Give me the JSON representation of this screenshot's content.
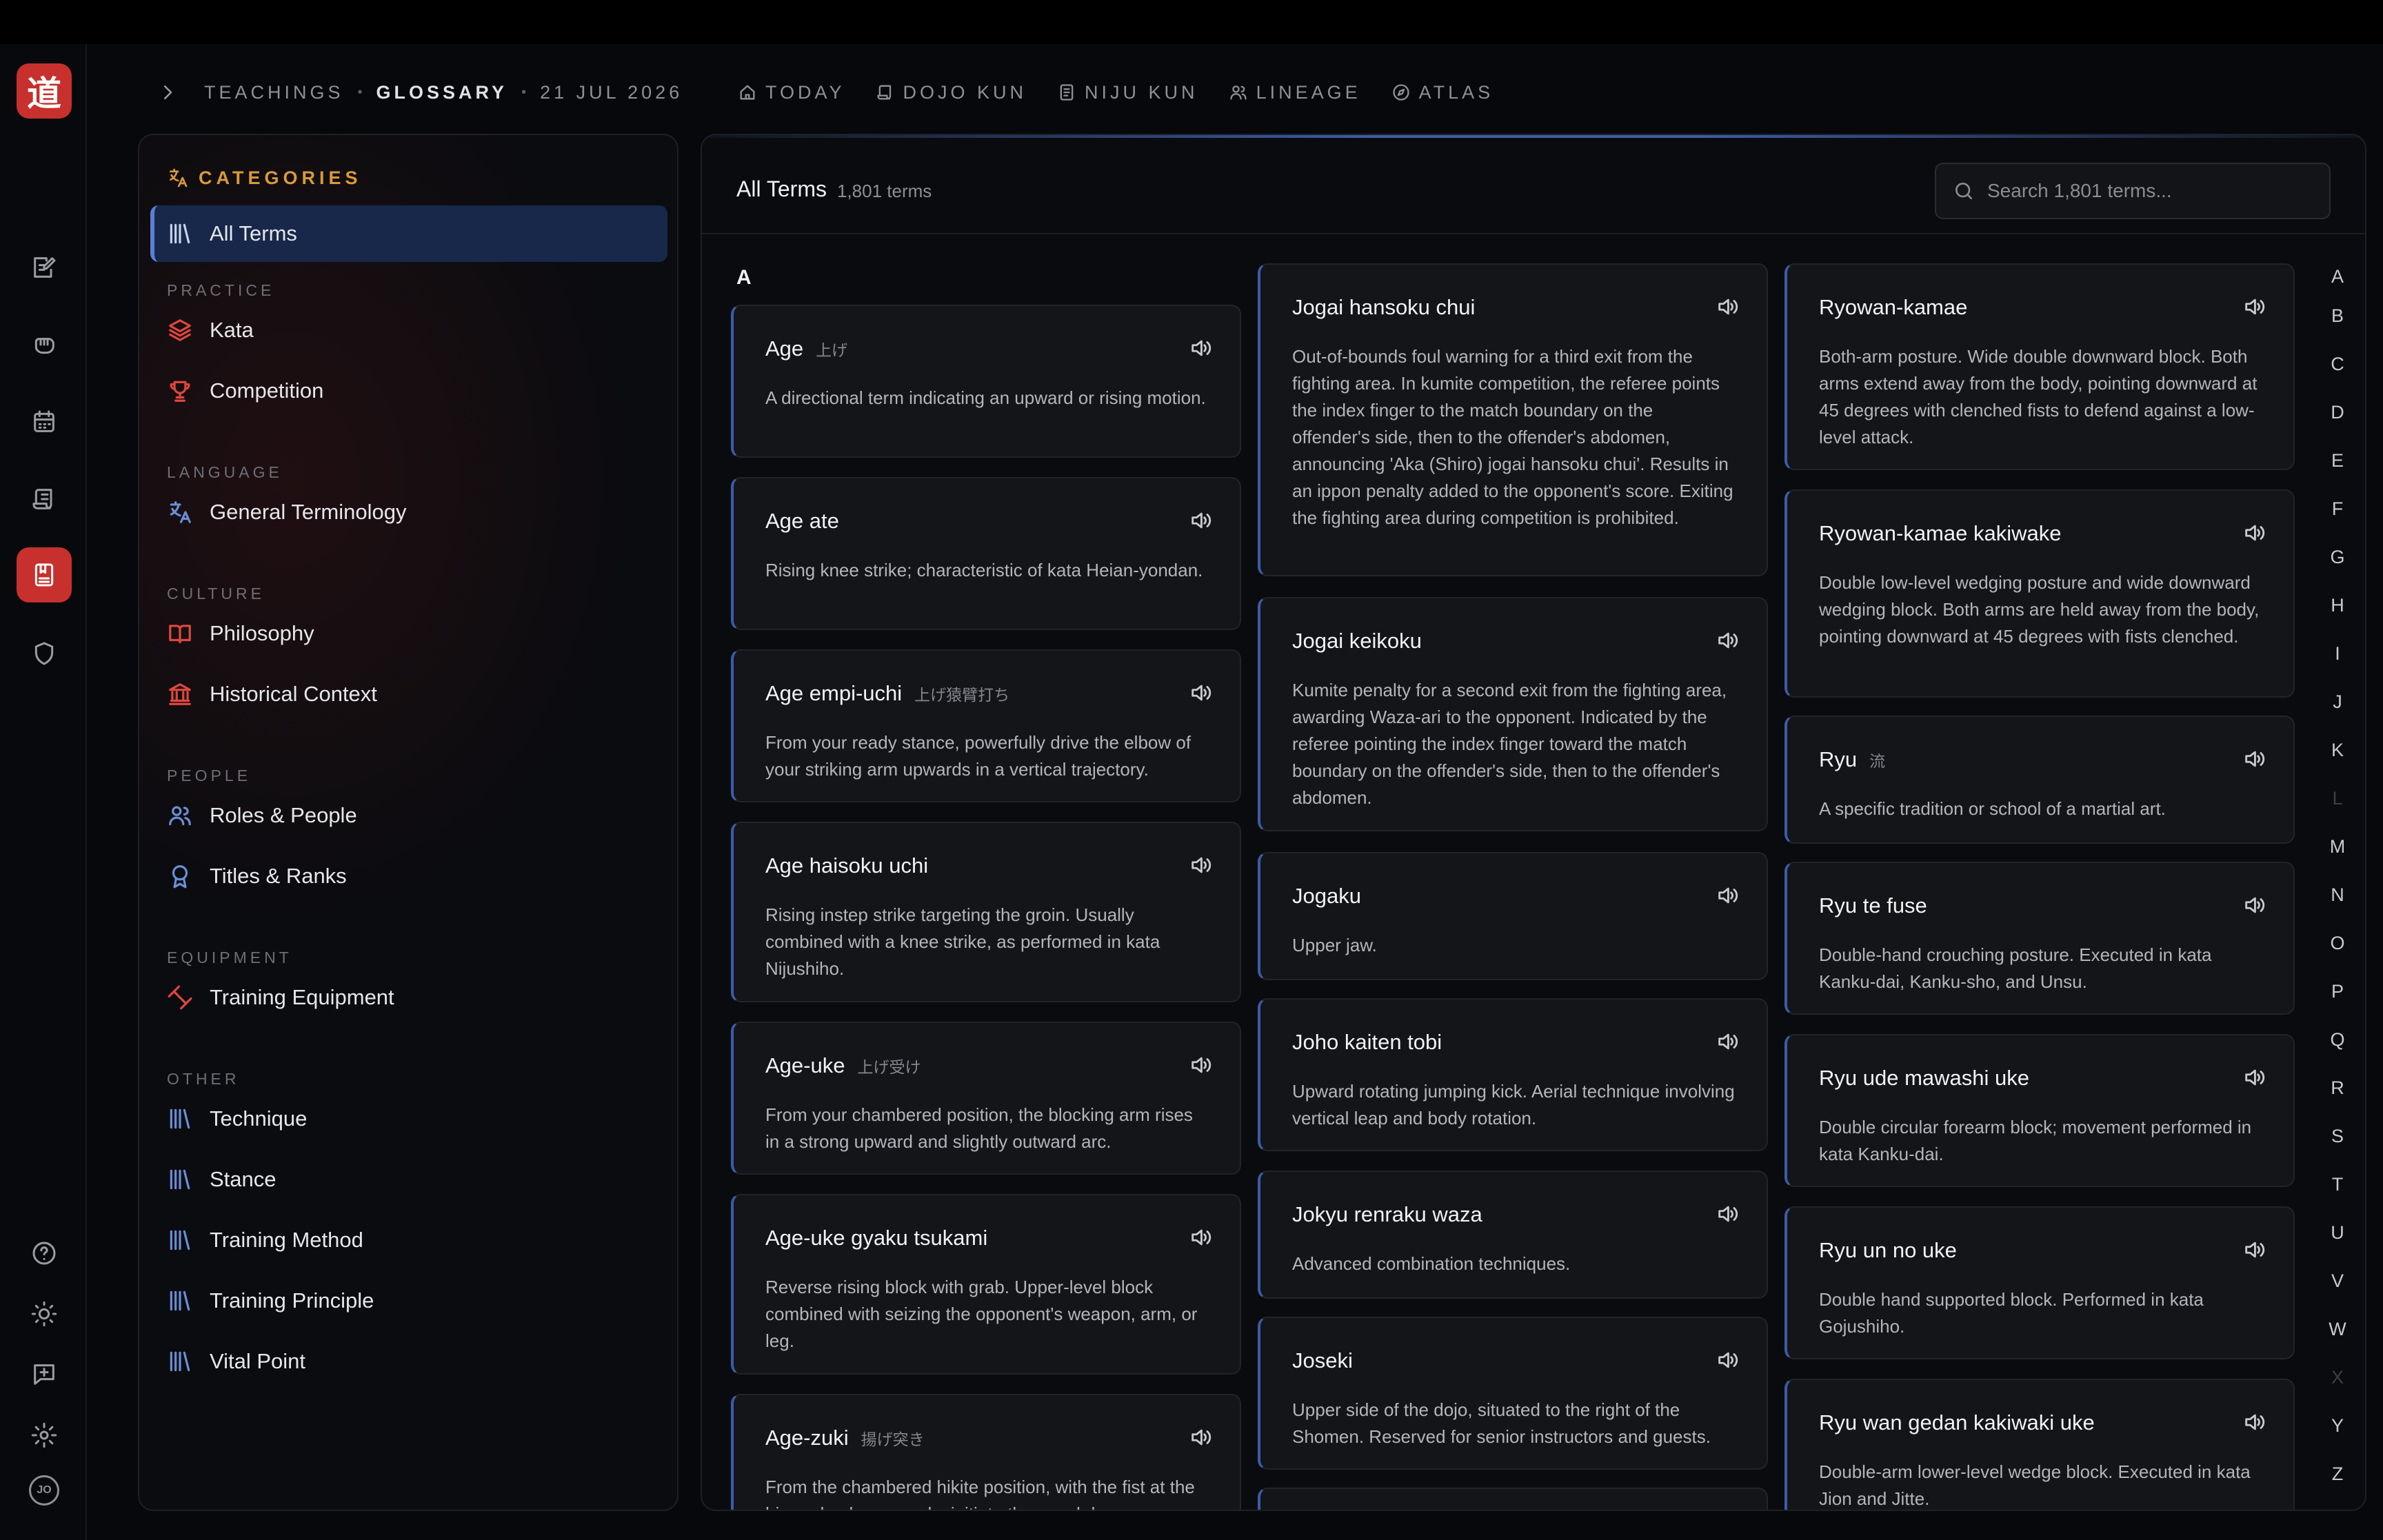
{
  "app": {
    "logo_glyph": "道",
    "brand_color": "#c7302c",
    "accent_color": "#3b5ca8",
    "category_heading_color": "#d99a3a"
  },
  "rail": {
    "items": [
      {
        "icon": "edit-note-icon"
      },
      {
        "icon": "fist-icon"
      },
      {
        "icon": "calendar-icon"
      },
      {
        "icon": "scroll-icon"
      },
      {
        "icon": "book-icon",
        "active": true
      },
      {
        "icon": "shield-icon"
      }
    ],
    "bottom_items": [
      {
        "icon": "help-icon"
      },
      {
        "icon": "sun-icon"
      },
      {
        "icon": "add-comment-icon"
      },
      {
        "icon": "settings-icon"
      }
    ],
    "avatar_initials": "JO"
  },
  "breadcrumb": {
    "section": "TEACHINGS",
    "current": "GLOSSARY",
    "date": "21 JUL 2026",
    "separator": "•"
  },
  "topnav": [
    {
      "label": "TODAY",
      "icon": "home-icon"
    },
    {
      "label": "DOJO KUN",
      "icon": "scroll-icon"
    },
    {
      "label": "NIJU KUN",
      "icon": "document-icon"
    },
    {
      "label": "LINEAGE",
      "icon": "people-icon"
    },
    {
      "label": "ATLAS",
      "icon": "compass-icon"
    }
  ],
  "categories": {
    "heading": "CATEGORIES",
    "all_terms": "All Terms",
    "groups": [
      {
        "label": "PRACTICE",
        "items": [
          {
            "label": "Kata",
            "icon": "layers-icon"
          },
          {
            "label": "Competition",
            "icon": "trophy-icon"
          }
        ]
      },
      {
        "label": "LANGUAGE",
        "items": [
          {
            "label": "General Terminology",
            "icon": "translate-icon"
          }
        ]
      },
      {
        "label": "CULTURE",
        "items": [
          {
            "label": "Philosophy",
            "icon": "open-book-icon"
          },
          {
            "label": "Historical Context",
            "icon": "temple-icon"
          }
        ]
      },
      {
        "label": "PEOPLE",
        "items": [
          {
            "label": "Roles & People",
            "icon": "people-icon"
          },
          {
            "label": "Titles & Ranks",
            "icon": "award-icon"
          }
        ]
      },
      {
        "label": "EQUIPMENT",
        "items": [
          {
            "label": "Training Equipment",
            "icon": "dumbbell-icon"
          }
        ]
      },
      {
        "label": "OTHER",
        "items": [
          {
            "label": "Technique",
            "icon": "library-icon"
          },
          {
            "label": "Stance",
            "icon": "library-icon"
          },
          {
            "label": "Training Method",
            "icon": "library-icon"
          },
          {
            "label": "Training Principle",
            "icon": "library-icon"
          },
          {
            "label": "Vital Point",
            "icon": "library-icon"
          }
        ]
      }
    ]
  },
  "terms": {
    "title": "All Terms",
    "count": "1,801 terms",
    "search_placeholder": "Search 1,801 terms...",
    "section_letter": "A",
    "columns": [
      [
        {
          "term": "Age",
          "jp": "上げ",
          "desc": "A directional term indicating an upward or rising motion."
        },
        {
          "term": "Age ate",
          "jp": "",
          "desc": "Rising knee strike; characteristic of kata Heian-yondan."
        },
        {
          "term": "Age empi-uchi",
          "jp": "上げ猿臂打ち",
          "desc": "From your ready stance, powerfully drive the elbow of your striking arm upwards in a vertical trajectory."
        },
        {
          "term": "Age haisoku uchi",
          "jp": "",
          "desc": "Rising instep strike targeting the groin. Usually combined with a knee strike, as performed in kata Nijushiho."
        },
        {
          "term": "Age-uke",
          "jp": "上げ受け",
          "desc": "From your chambered position, the blocking arm rises in a strong upward and slightly outward arc."
        },
        {
          "term": "Age-uke gyaku tsukami",
          "jp": "",
          "desc": "Reverse rising block with grab. Upper-level block combined with seizing the opponent's weapon, arm, or leg."
        },
        {
          "term": "Age-zuki",
          "jp": "揚げ突き",
          "desc": "From the chambered hikite position, with the fist at the hip and palm upwards, initiate the punch by"
        }
      ],
      [
        {
          "term": "Jogai hansoku chui",
          "jp": "",
          "desc": "Out-of-bounds foul warning for a third exit from the fighting area. In kumite competition, the referee points the index finger to the match boundary on the offender's side, then to the offender's abdomen, announcing 'Aka (Shiro) jogai hansoku chui'. Results in an ippon penalty added to the opponent's score. Exiting the fighting area during competition is prohibited."
        },
        {
          "term": "Jogai keikoku",
          "jp": "",
          "desc": "Kumite penalty for a second exit from the fighting area, awarding Waza-ari to the opponent. Indicated by the referee pointing the index finger toward the match boundary on the offender's side, then to the offender's abdomen."
        },
        {
          "term": "Jogaku",
          "jp": "",
          "desc": "Upper jaw."
        },
        {
          "term": "Joho kaiten tobi",
          "jp": "",
          "desc": "Upward rotating jumping kick. Aerial technique involving vertical leap and body rotation."
        },
        {
          "term": "Jokyu renraku waza",
          "jp": "",
          "desc": "Advanced combination techniques."
        },
        {
          "term": "Joseki",
          "jp": "",
          "desc": "Upper side of the dojo, situated to the right of the Shomen. Reserved for senior instructors and guests."
        },
        {
          "term": "",
          "jp": "",
          "desc": ""
        }
      ],
      [
        {
          "term": "Ryowan-kamae",
          "jp": "",
          "desc": "Both-arm posture. Wide double downward block. Both arms extend away from the body, pointing downward at 45 degrees with clenched fists to defend against a low-level attack."
        },
        {
          "term": "Ryowan-kamae kakiwake",
          "jp": "",
          "desc": "Double low-level wedging posture and wide downward wedging block. Both arms are held away from the body, pointing downward at 45 degrees with fists clenched."
        },
        {
          "term": "Ryu",
          "jp": "流",
          "desc": "A specific tradition or school of a martial art."
        },
        {
          "term": "Ryu te fuse",
          "jp": "",
          "desc": "Double-hand crouching posture. Executed in kata Kanku-dai, Kanku-sho, and Unsu."
        },
        {
          "term": "Ryu ude mawashi uke",
          "jp": "",
          "desc": "Double circular forearm block; movement performed in kata Kanku-dai."
        },
        {
          "term": "Ryu un no uke",
          "jp": "",
          "desc": "Double hand supported block. Performed in kata Gojushiho."
        },
        {
          "term": "Ryu wan gedan kakiwaki uke",
          "jp": "",
          "desc": "Double-arm lower-level wedge block. Executed in kata Jion and Jitte."
        }
      ]
    ]
  },
  "alphabet": [
    {
      "letter": "A",
      "enabled": true
    },
    {
      "letter": "B",
      "enabled": true
    },
    {
      "letter": "C",
      "enabled": true
    },
    {
      "letter": "D",
      "enabled": true
    },
    {
      "letter": "E",
      "enabled": true
    },
    {
      "letter": "F",
      "enabled": true
    },
    {
      "letter": "G",
      "enabled": true
    },
    {
      "letter": "H",
      "enabled": true
    },
    {
      "letter": "I",
      "enabled": true
    },
    {
      "letter": "J",
      "enabled": true
    },
    {
      "letter": "K",
      "enabled": true
    },
    {
      "letter": "L",
      "enabled": false
    },
    {
      "letter": "M",
      "enabled": true
    },
    {
      "letter": "N",
      "enabled": true
    },
    {
      "letter": "O",
      "enabled": true
    },
    {
      "letter": "P",
      "enabled": true
    },
    {
      "letter": "Q",
      "enabled": true
    },
    {
      "letter": "R",
      "enabled": true
    },
    {
      "letter": "S",
      "enabled": true
    },
    {
      "letter": "T",
      "enabled": true
    },
    {
      "letter": "U",
      "enabled": true
    },
    {
      "letter": "V",
      "enabled": true
    },
    {
      "letter": "W",
      "enabled": true
    },
    {
      "letter": "X",
      "enabled": false
    },
    {
      "letter": "Y",
      "enabled": true
    },
    {
      "letter": "Z",
      "enabled": true
    }
  ]
}
